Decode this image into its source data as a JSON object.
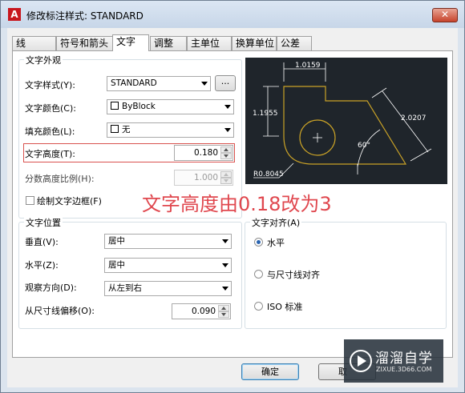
{
  "window": {
    "title": "修改标注样式: STANDARD",
    "close": "✕"
  },
  "tabs": [
    "线",
    "符号和箭头",
    "文字",
    "调整",
    "主单位",
    "换算单位",
    "公差"
  ],
  "text_appearance": {
    "group_title": "文字外观",
    "style_label": "文字样式(Y):",
    "style_value": "STANDARD",
    "style_browse": "...",
    "color_label": "文字颜色(C):",
    "color_value": "ByBlock",
    "fill_label": "填充颜色(L):",
    "fill_value": "无",
    "height_label": "文字高度(T):",
    "height_value": "0.180",
    "fraction_label": "分数高度比例(H):",
    "fraction_value": "1.000",
    "frame_label": "绘制文字边框(F)"
  },
  "text_placement": {
    "group_title": "文字位置",
    "vertical_label": "垂直(V):",
    "vertical_value": "居中",
    "horizontal_label": "水平(Z):",
    "horizontal_value": "居中",
    "view_label": "观察方向(D):",
    "view_value": "从左到右",
    "offset_label": "从尺寸线偏移(O):",
    "offset_value": "0.090"
  },
  "text_alignment": {
    "group_title": "文字对齐(A)",
    "options": [
      "水平",
      "与尺寸线对齐",
      "ISO 标准"
    ],
    "selected_index": 0
  },
  "preview": {
    "dims": [
      "1.0159",
      "1.1955",
      "2.0207",
      "60°",
      "R0.8045"
    ]
  },
  "annotation": "文字高度由0.18改为3",
  "buttons": {
    "ok": "确定",
    "cancel": "取"
  },
  "watermark": {
    "brand": "溜溜自学",
    "url": "ZIXUE.3D66.COM"
  },
  "colors": {
    "highlight": "#e0484f",
    "preview_bg": "#1f252b",
    "preview_line": "#c9a227"
  }
}
